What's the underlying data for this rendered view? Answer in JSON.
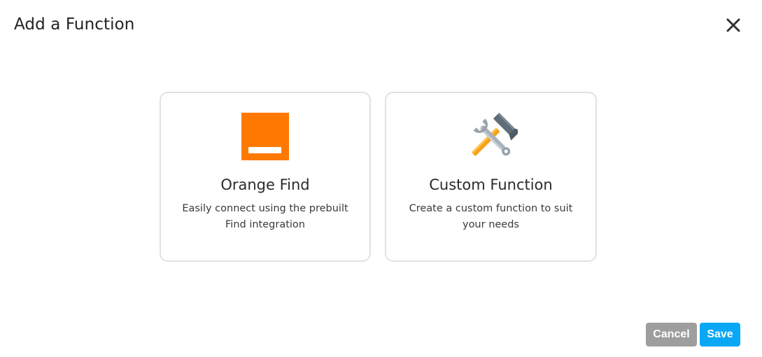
{
  "dialog": {
    "title": "Add a Function",
    "close_icon": "close-icon"
  },
  "cards": [
    {
      "icon": "orange-logo-icon",
      "title": "Orange Find",
      "description": "Easily connect using the prebuilt Find integration"
    },
    {
      "icon": "wrench-hammer-icon",
      "title": "Custom Function",
      "description": "Create a custom function to suit your needs"
    }
  ],
  "footer": {
    "cancel_label": "Cancel",
    "save_label": "Save"
  },
  "colors": {
    "orange_brand": "#ff7900",
    "save_button": "#0aa7f5",
    "cancel_button": "#9e9e9e",
    "card_border": "#e2e2e2"
  }
}
